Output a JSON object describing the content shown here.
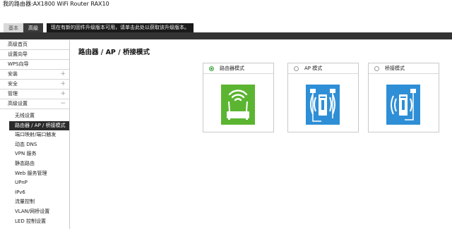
{
  "header": {
    "title": "我的路由器:AX1800 WiFi Router RAX10"
  },
  "tabs": [
    {
      "label": "基本"
    },
    {
      "label": "高级"
    }
  ],
  "notice": "现在有新的固件升级版本可用，请单击此处以获取该升级版本。",
  "sidebar": {
    "items": [
      {
        "label": "高级首页",
        "expandable": false
      },
      {
        "label": "设置向导",
        "expandable": false
      },
      {
        "label": "WPS向导",
        "expandable": false
      },
      {
        "label": "安装",
        "expandable": true,
        "symbol": "+"
      },
      {
        "label": "安全",
        "expandable": true,
        "symbol": "+"
      },
      {
        "label": "管理",
        "expandable": true,
        "symbol": "+"
      },
      {
        "label": "高级设置",
        "expandable": true,
        "symbol": "−"
      }
    ],
    "subitems": [
      {
        "label": "无线设置",
        "active": false
      },
      {
        "label": "路由器 / AP / 桥接模式",
        "active": true
      },
      {
        "label": "端口映射/端口触发",
        "active": false
      },
      {
        "label": "动态 DNS",
        "active": false
      },
      {
        "label": "VPN 服务",
        "active": false
      },
      {
        "label": "静态路由",
        "active": false
      },
      {
        "label": "Web 服务管理",
        "active": false
      },
      {
        "label": "UPnP",
        "active": false
      },
      {
        "label": "IPv6",
        "active": false
      },
      {
        "label": "流量控制",
        "active": false
      },
      {
        "label": "VLAN/网桥设置",
        "active": false
      },
      {
        "label": "LED 控制设置",
        "active": false
      }
    ]
  },
  "main": {
    "title": "路由器 / AP / 桥接模式",
    "modes": [
      {
        "label": "路由器模式",
        "selected": true,
        "icon": "router-icon",
        "color": "#5cb531"
      },
      {
        "label": "AP 模式",
        "selected": false,
        "icon": "access-point-icon",
        "color": "#2f8fd6"
      },
      {
        "label": "桥接模式",
        "selected": false,
        "icon": "bridge-icon",
        "color": "#2f8fd6"
      }
    ]
  }
}
